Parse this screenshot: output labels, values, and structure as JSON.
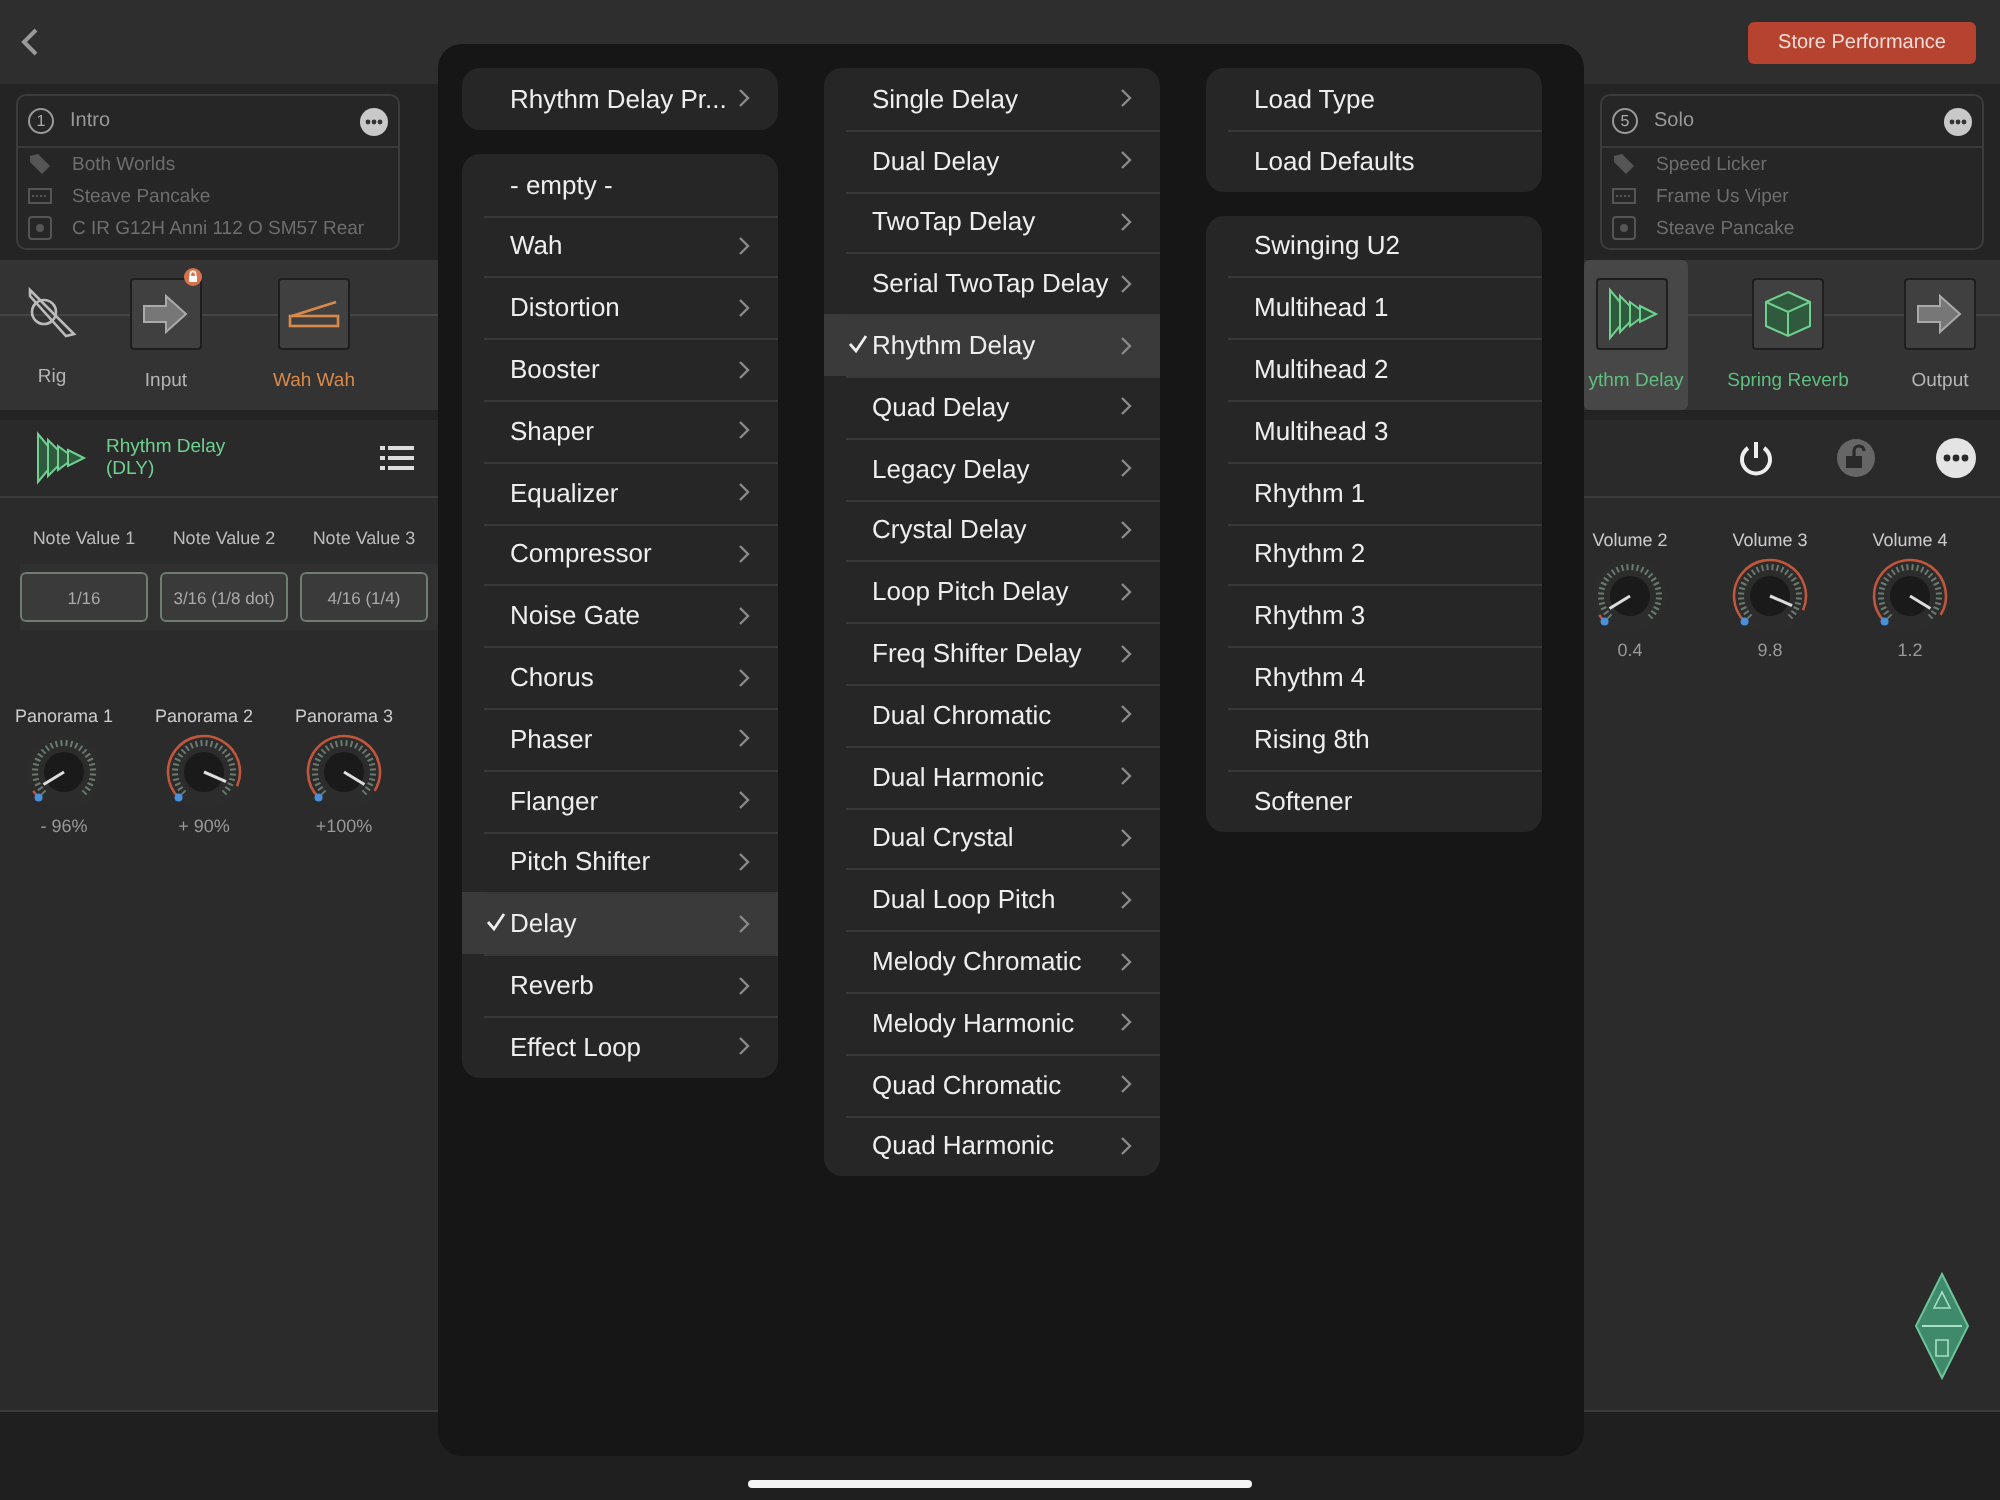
{
  "top_bar": {
    "store_button": "Store Performance"
  },
  "left": {
    "performance_card": {
      "number": "1",
      "title": "Intro",
      "rows": [
        {
          "kind": "tag",
          "text": "Both Worlds"
        },
        {
          "kind": "amp",
          "text": "Steave Pancake"
        },
        {
          "kind": "cabinet",
          "text": "C IR G12H Anni 112 O SM57 Rear"
        }
      ]
    },
    "chain": [
      {
        "kind": "rig",
        "label": "Rig",
        "color": "#b4b4b4",
        "selected": false,
        "locked": false
      },
      {
        "kind": "input",
        "label": "Input",
        "color": "#b4b4b4",
        "selected": false,
        "locked": true
      },
      {
        "kind": "wah",
        "label": "Wah Wah",
        "color": "#d98a4b",
        "selected": false,
        "locked": false
      }
    ],
    "module": {
      "name": "Rhythm Delay",
      "code": "(DLY)"
    },
    "note_values": [
      {
        "label": "Note Value 1",
        "value": "1/16"
      },
      {
        "label": "Note Value 2",
        "value": "3/16 (1/8 dot)"
      },
      {
        "label": "Note Value 3",
        "value": "4/16 (1/4)"
      }
    ],
    "knobs": [
      {
        "label": "Panorama 1",
        "reading": "- 96%"
      },
      {
        "label": "Panorama 2",
        "reading": "+ 90%"
      },
      {
        "label": "Panorama 3",
        "reading": "+100%"
      }
    ]
  },
  "right": {
    "performance_card": {
      "number": "5",
      "title": "Solo",
      "rows": [
        {
          "kind": "tag",
          "text": "Speed Licker"
        },
        {
          "kind": "amp",
          "text": "Frame Us Viper"
        },
        {
          "kind": "cabinet",
          "text": "Steave Pancake"
        }
      ]
    },
    "chain": [
      {
        "kind": "delay",
        "label": "ythm Delay",
        "color": "#5fbf7f",
        "selected": true,
        "locked": false
      },
      {
        "kind": "reverb",
        "label": "Spring Reverb",
        "color": "#5fbf7f",
        "selected": false,
        "locked": false
      },
      {
        "kind": "output",
        "label": "Output",
        "color": "#b4b4b4",
        "selected": false,
        "locked": false
      }
    ],
    "knobs": [
      {
        "label": "Volume 2",
        "reading": "0.4"
      },
      {
        "label": "Volume 3",
        "reading": "9.8"
      },
      {
        "label": "Volume 4",
        "reading": "1.2"
      }
    ]
  },
  "menu": {
    "columns": [
      {
        "groups": [
          [
            {
              "label": "Rhythm Delay Pr...",
              "submenu": true,
              "selected": false
            }
          ],
          [
            {
              "label": "- empty -",
              "submenu": false,
              "selected": false
            },
            {
              "label": "Wah",
              "submenu": true,
              "selected": false
            },
            {
              "label": "Distortion",
              "submenu": true,
              "selected": false
            },
            {
              "label": "Booster",
              "submenu": true,
              "selected": false
            },
            {
              "label": "Shaper",
              "submenu": true,
              "selected": false
            },
            {
              "label": "Equalizer",
              "submenu": true,
              "selected": false
            },
            {
              "label": "Compressor",
              "submenu": true,
              "selected": false
            },
            {
              "label": "Noise Gate",
              "submenu": true,
              "selected": false
            },
            {
              "label": "Chorus",
              "submenu": true,
              "selected": false
            },
            {
              "label": "Phaser",
              "submenu": true,
              "selected": false
            },
            {
              "label": "Flanger",
              "submenu": true,
              "selected": false
            },
            {
              "label": "Pitch Shifter",
              "submenu": true,
              "selected": false
            },
            {
              "label": "Delay",
              "submenu": true,
              "selected": true
            },
            {
              "label": "Reverb",
              "submenu": true,
              "selected": false
            },
            {
              "label": "Effect Loop",
              "submenu": true,
              "selected": false
            }
          ]
        ]
      },
      {
        "groups": [
          [
            {
              "label": "Single Delay",
              "submenu": true,
              "selected": false
            },
            {
              "label": "Dual Delay",
              "submenu": true,
              "selected": false
            },
            {
              "label": "TwoTap Delay",
              "submenu": true,
              "selected": false
            },
            {
              "label": "Serial TwoTap Delay",
              "submenu": true,
              "selected": false
            },
            {
              "label": "Rhythm Delay",
              "submenu": true,
              "selected": true
            },
            {
              "label": "Quad Delay",
              "submenu": true,
              "selected": false
            },
            {
              "label": "Legacy Delay",
              "submenu": true,
              "selected": false
            },
            {
              "label": "Crystal Delay",
              "submenu": true,
              "selected": false
            },
            {
              "label": "Loop Pitch Delay",
              "submenu": true,
              "selected": false
            },
            {
              "label": "Freq Shifter Delay",
              "submenu": true,
              "selected": false
            },
            {
              "label": "Dual Chromatic",
              "submenu": true,
              "selected": false
            },
            {
              "label": "Dual Harmonic",
              "submenu": true,
              "selected": false
            },
            {
              "label": "Dual Crystal",
              "submenu": true,
              "selected": false
            },
            {
              "label": "Dual Loop Pitch",
              "submenu": true,
              "selected": false
            },
            {
              "label": "Melody Chromatic",
              "submenu": true,
              "selected": false
            },
            {
              "label": "Melody Harmonic",
              "submenu": true,
              "selected": false
            },
            {
              "label": "Quad Chromatic",
              "submenu": true,
              "selected": false
            },
            {
              "label": "Quad Harmonic",
              "submenu": true,
              "selected": false
            }
          ]
        ]
      },
      {
        "groups": [
          [
            {
              "label": "Load Type",
              "submenu": false,
              "selected": false
            },
            {
              "label": "Load Defaults",
              "submenu": false,
              "selected": false
            }
          ],
          [
            {
              "label": "Swinging U2",
              "submenu": false,
              "selected": false
            },
            {
              "label": "Multihead 1",
              "submenu": false,
              "selected": false
            },
            {
              "label": "Multihead 2",
              "submenu": false,
              "selected": false
            },
            {
              "label": "Multihead 3",
              "submenu": false,
              "selected": false
            },
            {
              "label": "Rhythm 1",
              "submenu": false,
              "selected": false
            },
            {
              "label": "Rhythm 2",
              "submenu": false,
              "selected": false
            },
            {
              "label": "Rhythm 3",
              "submenu": false,
              "selected": false
            },
            {
              "label": "Rhythm 4",
              "submenu": false,
              "selected": false
            },
            {
              "label": "Rising 8th",
              "submenu": false,
              "selected": false
            },
            {
              "label": "Softener",
              "submenu": false,
              "selected": false
            }
          ]
        ]
      }
    ]
  }
}
